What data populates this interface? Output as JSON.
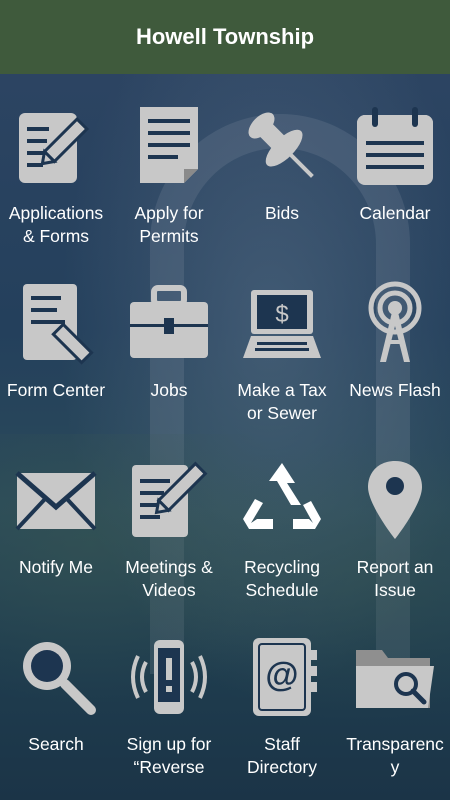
{
  "header": {
    "title": "Howell Township"
  },
  "tiles": [
    {
      "label": "Applications\n& Forms",
      "icon": "form-edit-icon"
    },
    {
      "label": "Apply for\nPermits",
      "icon": "document-icon"
    },
    {
      "label": "Bids",
      "icon": "pushpin-icon"
    },
    {
      "label": "Calendar",
      "icon": "calendar-icon"
    },
    {
      "label": "Form Center",
      "icon": "form-pen-icon"
    },
    {
      "label": "Jobs",
      "icon": "briefcase-icon"
    },
    {
      "label": "Make a Tax\nor Sewer",
      "icon": "laptop-dollar-icon"
    },
    {
      "label": "News Flash",
      "icon": "broadcast-tower-icon"
    },
    {
      "label": "Notify Me",
      "icon": "envelope-icon"
    },
    {
      "label": "Meetings &\nVideos",
      "icon": "notepad-pencil-icon"
    },
    {
      "label": "Recycling\nSchedule",
      "icon": "recycle-icon"
    },
    {
      "label": "Report an\nIssue",
      "icon": "map-pin-icon"
    },
    {
      "label": "Search",
      "icon": "magnifier-icon"
    },
    {
      "label": "Sign up for\n“Reverse",
      "icon": "phone-alert-icon"
    },
    {
      "label": "Staff\nDirectory",
      "icon": "address-book-icon"
    },
    {
      "label": "Transparenc\ny",
      "icon": "folder-search-icon"
    }
  ],
  "colors": {
    "header_bg": "#3f5a3c",
    "icon_fill": "#c8c8c8",
    "text": "#ffffff"
  }
}
